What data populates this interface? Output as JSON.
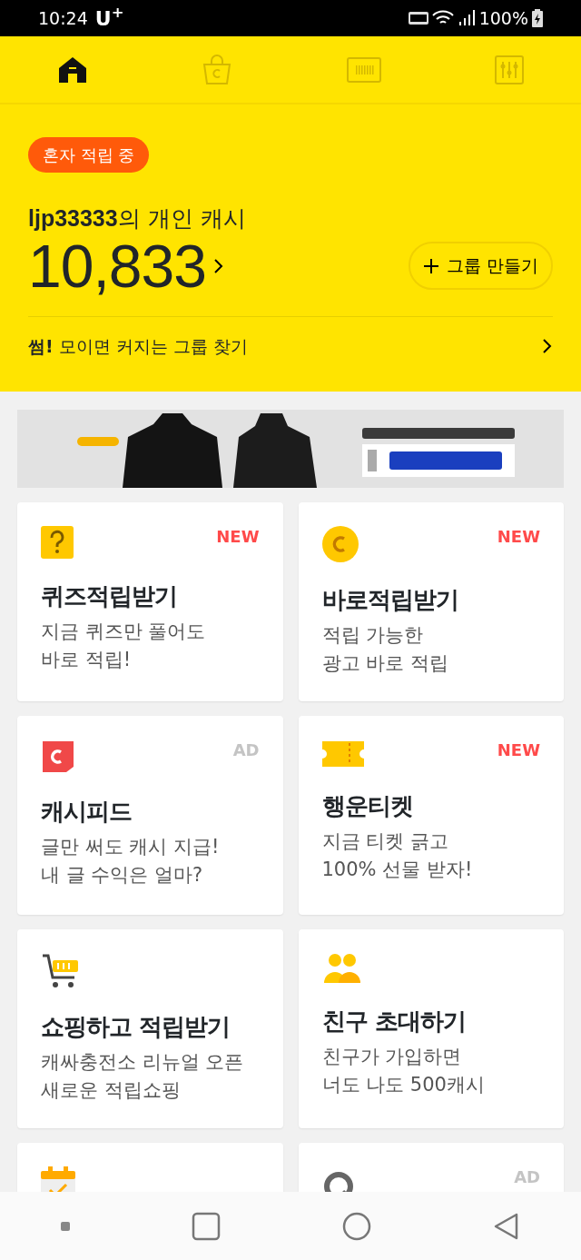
{
  "status_bar": {
    "time": "10:24",
    "carrier": "U$^{+}$",
    "battery": "100%"
  },
  "tabs": [
    {
      "kind": "home",
      "selected": true
    },
    {
      "kind": "shop",
      "selected": false
    },
    {
      "kind": "barcode",
      "selected": false
    },
    {
      "kind": "settings",
      "selected": false
    }
  ],
  "header": {
    "badge": "혼자 적립 중",
    "title": "**ljp33333**의 개인 캐시",
    "amount": "10,833",
    "create_button": "그룹 만들기",
    "group_link": "**썸!** 모이면 커지는 그룹 찾기"
  },
  "cards": [
    {
      "kind": "quiz",
      "tag": "NEW",
      "title": "퀴즈적립받기",
      "lines": [
        "지금 퀴즈만 풀어도",
        "바로 적립!"
      ]
    },
    {
      "kind": "coin",
      "tag": "NEW",
      "title": "바로적립받기",
      "lines": [
        "적립 가능한",
        "광고 바로 적립"
      ]
    },
    {
      "kind": "feed",
      "tag": "AD",
      "title": "캐시피드",
      "lines": [
        "글만 써도 캐시 지급!",
        "내 글 수익은 얼마?"
      ]
    },
    {
      "kind": "ticket",
      "tag": "NEW",
      "title": "행운티켓",
      "lines": [
        "지금 티켓 긁고",
        "100% 선물 받자!"
      ]
    },
    {
      "kind": "cart",
      "title": "쇼핑하고 적립받기",
      "lines": [
        "캐싸충전소 리뉴얼 오픈",
        "새로운 적립쇼핑"
      ]
    },
    {
      "kind": "friends",
      "title": "친구 초대하기",
      "lines": [
        "친구가 가입하면",
        "너도 나도 500캐시"
      ]
    },
    {
      "kind": "calendar"
    },
    {
      "kind": "q",
      "tag": "AD"
    }
  ]
}
